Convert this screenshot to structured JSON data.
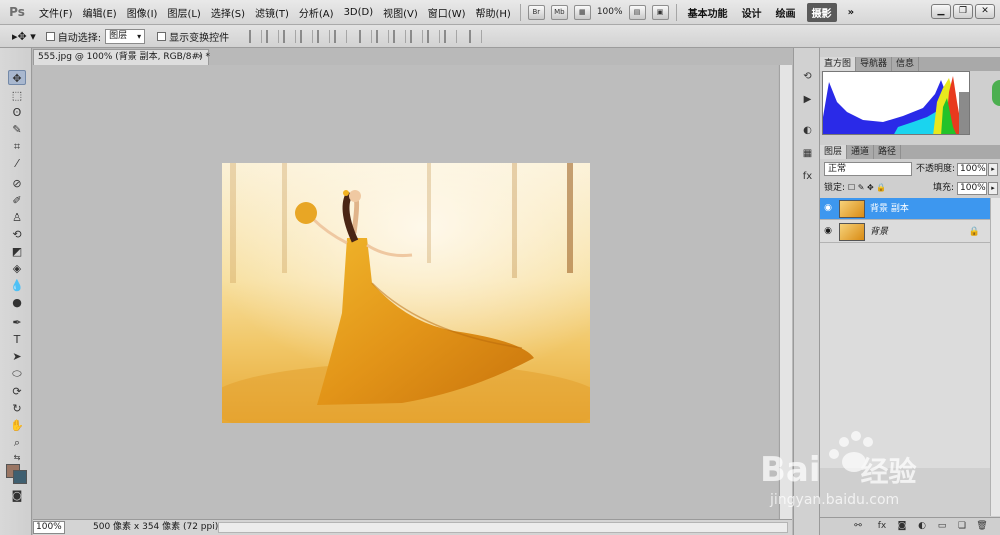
{
  "app": {
    "logo": "Ps"
  },
  "menu": [
    "文件(F)",
    "编辑(E)",
    "图像(I)",
    "图层(L)",
    "选择(S)",
    "滤镜(T)",
    "分析(A)",
    "3D(D)",
    "视图(V)",
    "窗口(W)",
    "帮助(H)"
  ],
  "appbar": {
    "br": "Br",
    "mb": "Mb",
    "zoom": "100%"
  },
  "workspaces": {
    "essentials": "基本功能",
    "design": "设计",
    "painting": "绘画",
    "active": "摄影",
    "more": "»"
  },
  "options": {
    "auto_select_label": "自动选择:",
    "auto_select_value": "图层",
    "show_transform_label": "显示变换控件"
  },
  "document": {
    "tab_title": "555.jpg @ 100% (背景 副本, RGB/8#) *",
    "status_zoom": "100%",
    "status_info": "500 像素 x 354 像素 (72 ppi)"
  },
  "panels": {
    "top_tabs": [
      "直方图",
      "导航器",
      "信息"
    ],
    "layer_tabs": [
      "图层",
      "通道",
      "路径"
    ],
    "blend_mode": "正常",
    "opacity_label": "不透明度:",
    "opacity_value": "100%",
    "lock_label": "锁定:",
    "fill_label": "填充:",
    "fill_value": "100%"
  },
  "layers": [
    {
      "name": "背景 副本",
      "selected": true
    },
    {
      "name": "背景",
      "selected": false
    }
  ],
  "watermark": {
    "brand_text": "Bai",
    "brand_cn": "经验",
    "url": "jingyan.baidu.com"
  }
}
